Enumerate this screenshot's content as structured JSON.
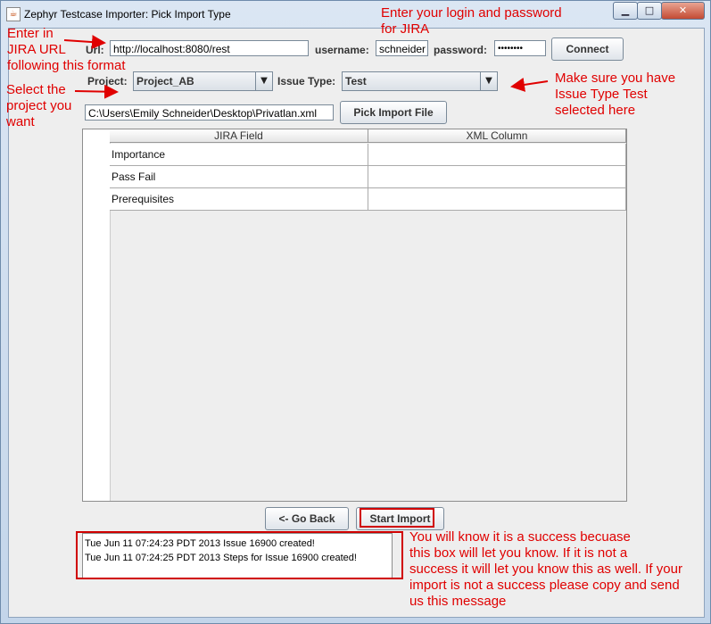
{
  "window": {
    "title": "Zephyr Testcase Importer: Pick Import Type",
    "controls": {
      "minimize": "▁",
      "maximize": "□",
      "close": "✕"
    }
  },
  "connection": {
    "url_label": "Url:",
    "url_value": "http://localhost:8080/rest",
    "username_label": "username:",
    "username_value": "schneider",
    "password_label": "password:",
    "password_value": "••••••••",
    "connect_label": "Connect"
  },
  "selectors": {
    "project_label": "Project:",
    "project_value": "Project_AB",
    "issue_type_label": "Issue Type:",
    "issue_type_value": "Test"
  },
  "file": {
    "path_value": "C:\\Users\\Emily Schneider\\Desktop\\Privatlan.xml",
    "pick_label": "Pick Import File"
  },
  "table": {
    "columns": [
      "JIRA Field",
      "XML Column"
    ],
    "rows": [
      [
        "Importance",
        ""
      ],
      [
        "Pass Fail",
        ""
      ],
      [
        "Prerequisites",
        ""
      ]
    ]
  },
  "actions": {
    "back_label": "<- Go Back",
    "start_label": "Start Import"
  },
  "log": [
    "Tue Jun 11 07:24:23 PDT 2013 Issue 16900 created!",
    "Tue Jun 11 07:24:25 PDT 2013 Steps for Issue 16900 created!"
  ],
  "annotations": {
    "jira_url": "Enter in\nJIRA URL\nfollowing this format",
    "login": "Enter your login and password\nfor JIRA",
    "project": "Select the\nproject you\nwant",
    "issue_type": "Make sure you have\nIssue Type Test\nselected here",
    "success": "You will know it is a success becuase\nthis box will let you know. If it is not a\nsuccess it will let you know this as well. If your\nimport is not a success please copy and send\nus this message"
  },
  "colors": {
    "annotation": "#e00000",
    "panel": "#eeeeee",
    "frame": "#c3d5ea"
  }
}
